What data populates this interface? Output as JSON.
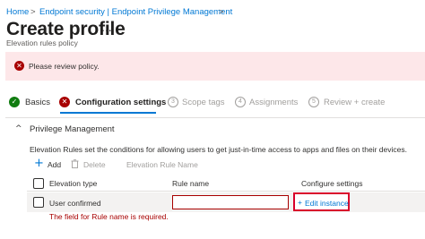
{
  "breadcrumb": {
    "home": "Home",
    "separator": ">",
    "path": "Endpoint security | Endpoint Privilege Management"
  },
  "header": {
    "title": "Create profile",
    "more": "...",
    "subtitle": "Elevation rules policy"
  },
  "banner": {
    "message": "Please review policy.",
    "icon": "error-icon",
    "color": "#fde7e9"
  },
  "wizard": {
    "steps": [
      {
        "label": "Basics",
        "state": "complete",
        "icon": "✓"
      },
      {
        "label": "Configuration settings",
        "state": "error-active",
        "icon": "✕"
      },
      {
        "label": "Scope tags",
        "state": "pending",
        "number": "3"
      },
      {
        "label": "Assignments",
        "state": "pending",
        "number": "4"
      },
      {
        "label": "Review + create",
        "state": "pending",
        "number": "5"
      }
    ]
  },
  "section": {
    "title": "Privilege Management",
    "description": "Elevation Rules set the conditions for allowing users to get just-in-time access to apps and files on their devices."
  },
  "toolbar": {
    "add_label": "Add",
    "delete_label": "Delete",
    "rule_name_label": "Elevation Rule Name"
  },
  "table": {
    "columns": [
      "Elevation type",
      "Rule name",
      "Configure settings"
    ],
    "rows": [
      {
        "elevation_type": "User confirmed",
        "rule_name": "",
        "action": "Edit instance",
        "error": "The field for Rule name is required."
      }
    ]
  },
  "colors": {
    "accent": "#0078d4",
    "error": "#a80000",
    "success": "#107c10",
    "highlight": "#d9002b"
  }
}
